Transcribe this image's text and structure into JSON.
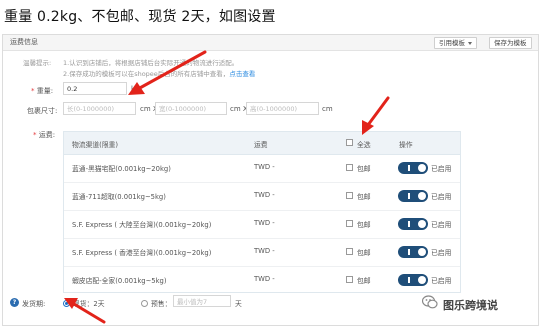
{
  "caption": "重量 0.2kg、不包邮、现货 2天，如图设置",
  "header": {
    "title": "运费信息",
    "btn_template": "引用模板",
    "btn_save": "保存为模板"
  },
  "tips": {
    "label": "温馨提示:",
    "line1": "1.认识到店铺后，将根据店铺后台实际开通的物流进行适配。",
    "line2_prefix": "2.保存成功的模板可以在shopee后台的所有店铺中查看，",
    "line2_link": "点击查看"
  },
  "weight": {
    "label": "重量:",
    "value": "0.2",
    "unit": "kg"
  },
  "size": {
    "label": "包裹尺寸:",
    "length_placeholder": "长(0-1000000)",
    "width_placeholder": "宽(0-1000000)",
    "height_placeholder": "高(0-1000000)",
    "unit1": "cm X",
    "unit2": "cm X",
    "unit3": "cm"
  },
  "shipping": {
    "label": "运费:",
    "headers": {
      "channel": "物流渠道(限重)",
      "fee": "运费",
      "select_all": "全选",
      "action": "操作"
    },
    "rows": [
      {
        "name": "蓝通-黑猫宅配(0.001kg~20kg)",
        "fee": "TWD -",
        "free": "包邮",
        "status": "已启用"
      },
      {
        "name": "蓝通-711超取(0.001kg~5kg)",
        "fee": "TWD -",
        "free": "包邮",
        "status": "已启用"
      },
      {
        "name": "S.F. Express ( 大陸至台灣)(0.001kg~20kg)",
        "fee": "TWD -",
        "free": "包邮",
        "status": "已启用"
      },
      {
        "name": "S.F. Express ( 香港至台灣)(0.001kg~20kg)",
        "fee": "TWD -",
        "free": "包邮",
        "status": "已启用"
      },
      {
        "name": "蝦皮店配-全家(0.001kg~5kg)",
        "fee": "TWD -",
        "free": "包邮",
        "status": "已启用"
      }
    ]
  },
  "delivery": {
    "label": "发货期:",
    "option_stock": "现货：2天",
    "option_presale": "预售：",
    "presale_placeholder": "最小值为7",
    "unit": "天"
  },
  "watermark": "图乐跨境说",
  "colors": {
    "toggle": "#1f4e79",
    "arrow": "#e2231a",
    "link": "#2b8be0"
  }
}
